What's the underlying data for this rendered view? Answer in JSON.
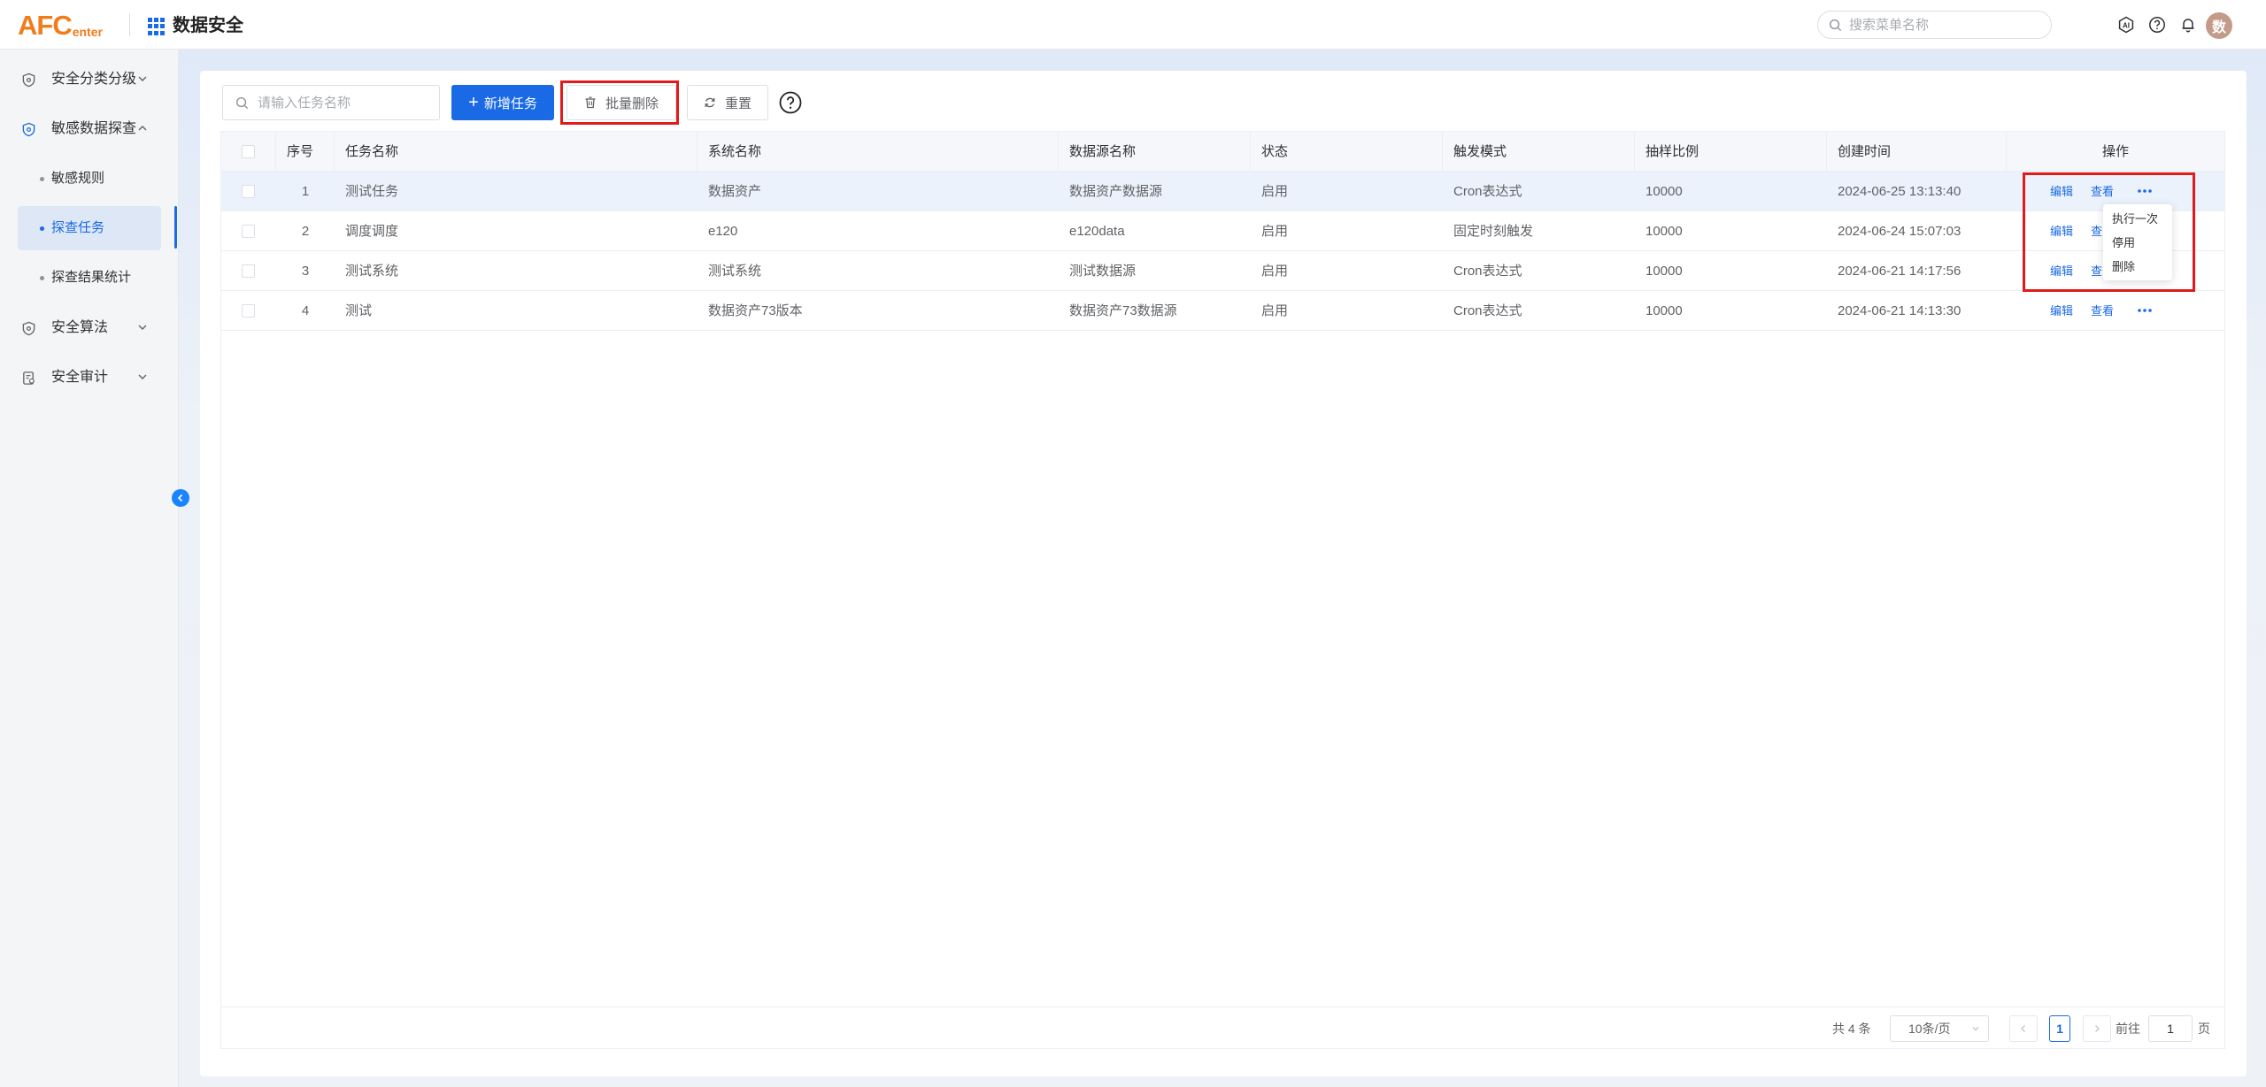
{
  "header": {
    "logo_main": "AFC",
    "logo_sub": "enter",
    "app_title": "数据安全",
    "search_placeholder": "搜索菜单名称",
    "avatar_text": "数"
  },
  "sidebar": {
    "items": [
      {
        "label": "安全分类分级",
        "expanded": false
      },
      {
        "label": "敏感数据探查",
        "expanded": true
      },
      {
        "label": "安全算法",
        "expanded": false
      },
      {
        "label": "安全审计",
        "expanded": false
      }
    ],
    "sub_items": [
      {
        "label": "敏感规则",
        "active": false
      },
      {
        "label": "探查任务",
        "active": true
      },
      {
        "label": "探查结果统计",
        "active": false
      }
    ],
    "accent_color": "#1a6ae5"
  },
  "toolbar": {
    "search_placeholder": "请输入任务名称",
    "add_label": "新增任务",
    "batch_delete_label": "批量删除",
    "reset_label": "重置"
  },
  "table": {
    "headers": [
      "序号",
      "任务名称",
      "系统名称",
      "数据源名称",
      "状态",
      "触发模式",
      "抽样比例",
      "创建时间",
      "操作"
    ],
    "rows": [
      {
        "index": "1",
        "task": "测试任务",
        "system": "数据资产",
        "source": "数据资产数据源",
        "status": "启用",
        "trigger": "Cron表达式",
        "ratio": "10000",
        "created": "2024-06-25 13:13:40"
      },
      {
        "index": "2",
        "task": "调度调度",
        "system": "e120",
        "source": "e120data",
        "status": "启用",
        "trigger": "固定时刻触发",
        "ratio": "10000",
        "created": "2024-06-24 15:07:03"
      },
      {
        "index": "3",
        "task": "测试系统",
        "system": "测试系统",
        "source": "测试数据源",
        "status": "启用",
        "trigger": "Cron表达式",
        "ratio": "10000",
        "created": "2024-06-21 14:17:56"
      },
      {
        "index": "4",
        "task": "测试",
        "system": "数据资产73版本",
        "source": "数据资产73数据源",
        "status": "启用",
        "trigger": "Cron表达式",
        "ratio": "10000",
        "created": "2024-06-21 14:13:30"
      }
    ],
    "actions": {
      "edit": "编辑",
      "view": "查看",
      "view_partial": "查"
    },
    "more_menu": [
      "执行一次",
      "停用",
      "删除"
    ]
  },
  "pagination": {
    "total": "共 4 条",
    "page_size": "10条/页",
    "current_page": "1",
    "goto_label": "前往",
    "goto_value": "1",
    "page_unit": "页"
  }
}
